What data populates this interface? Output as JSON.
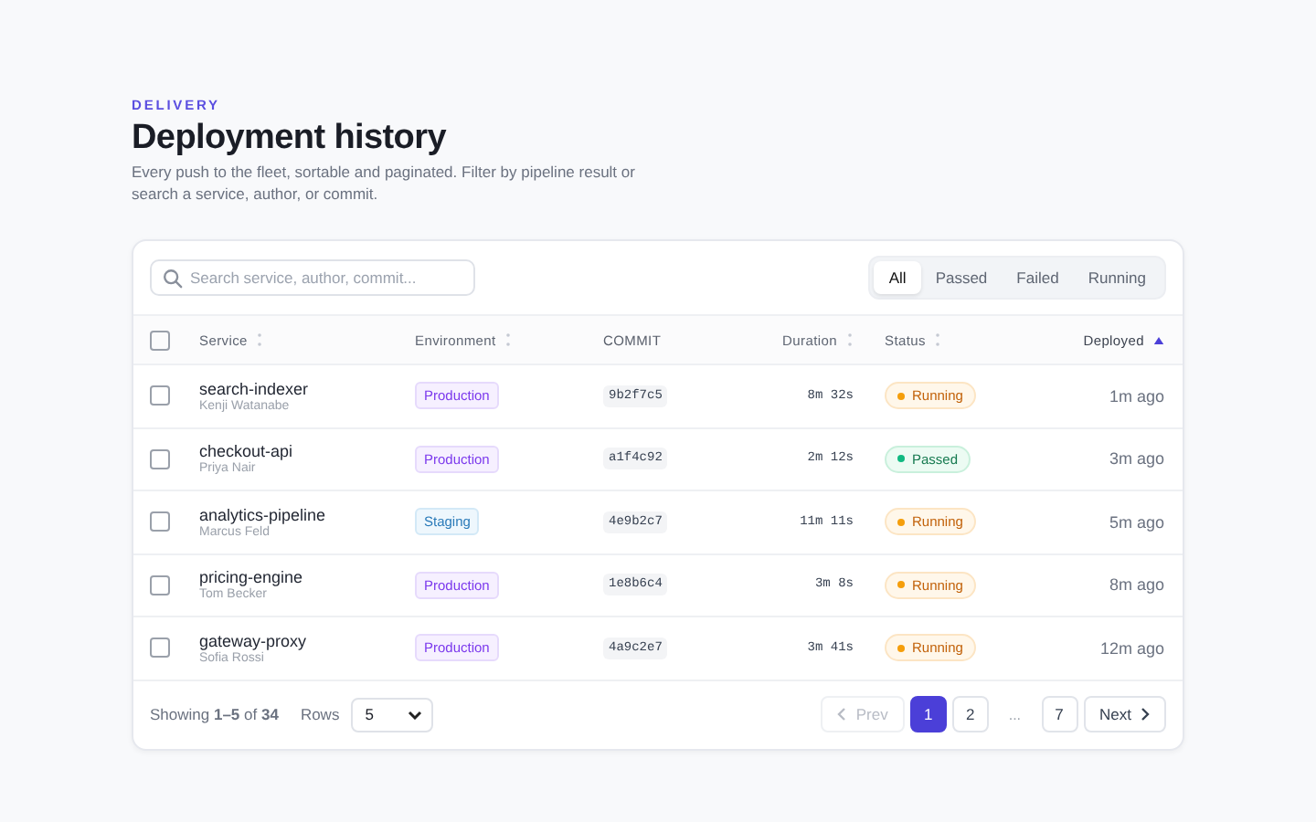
{
  "header": {
    "eyebrow": "DELIVERY",
    "title": "Deployment history",
    "description": "Every push to the fleet, sortable and paginated. Filter by pipeline result or search a service, author, or commit."
  },
  "search": {
    "placeholder": "Search service, author, commit..."
  },
  "filters": [
    {
      "label": "All",
      "selected": true
    },
    {
      "label": "Passed",
      "selected": false
    },
    {
      "label": "Failed",
      "selected": false
    },
    {
      "label": "Running",
      "selected": false
    }
  ],
  "table": {
    "select_all": {
      "checked": false
    },
    "columns": [
      {
        "label": "Service",
        "sortable": true,
        "sorted": false
      },
      {
        "label": "Environment",
        "sortable": true,
        "sorted": false
      },
      {
        "label": "COMMIT",
        "sortable": false
      },
      {
        "label": "Duration",
        "sortable": true,
        "sorted": false
      },
      {
        "label": "Status",
        "sortable": true,
        "sorted": false
      },
      {
        "label": "Deployed",
        "sortable": true,
        "sorted": true
      }
    ],
    "rows": [
      {
        "checked": false,
        "service": "search-indexer",
        "author": "Kenji Watanabe",
        "environment": {
          "label": "Production",
          "kind": "production"
        },
        "commit": "9b2f7c5",
        "duration": "8m 32s",
        "status": {
          "label": "Running",
          "kind": "running"
        },
        "deployed": "1m ago"
      },
      {
        "checked": false,
        "service": "checkout-api",
        "author": "Priya Nair",
        "environment": {
          "label": "Production",
          "kind": "production"
        },
        "commit": "a1f4c92",
        "duration": "2m 12s",
        "status": {
          "label": "Passed",
          "kind": "passed"
        },
        "deployed": "3m ago"
      },
      {
        "checked": false,
        "service": "analytics-pipeline",
        "author": "Marcus Feld",
        "environment": {
          "label": "Staging",
          "kind": "staging"
        },
        "commit": "4e9b2c7",
        "duration": "11m 11s",
        "status": {
          "label": "Running",
          "kind": "running"
        },
        "deployed": "5m ago"
      },
      {
        "checked": false,
        "service": "pricing-engine",
        "author": "Tom Becker",
        "environment": {
          "label": "Production",
          "kind": "production"
        },
        "commit": "1e8b6c4",
        "duration": "3m 8s",
        "status": {
          "label": "Running",
          "kind": "running"
        },
        "deployed": "8m ago"
      },
      {
        "checked": false,
        "service": "gateway-proxy",
        "author": "Sofia Rossi",
        "environment": {
          "label": "Production",
          "kind": "production"
        },
        "commit": "4a9c2e7",
        "duration": "3m 41s",
        "status": {
          "label": "Running",
          "kind": "running"
        },
        "deployed": "12m ago"
      }
    ]
  },
  "footer": {
    "summary": "Showing **1–5** of **34**",
    "rows_label": "Rows",
    "rows_value": "5",
    "prev": {
      "label": "Prev",
      "disabled": true
    },
    "pages": [
      {
        "kind": "page",
        "label": "1",
        "selected": true
      },
      {
        "kind": "page",
        "label": "2",
        "selected": false
      },
      {
        "kind": "ellipsis",
        "label": "..."
      },
      {
        "kind": "page",
        "label": "7",
        "selected": false
      }
    ],
    "next": {
      "label": "Next",
      "disabled": false
    }
  }
}
